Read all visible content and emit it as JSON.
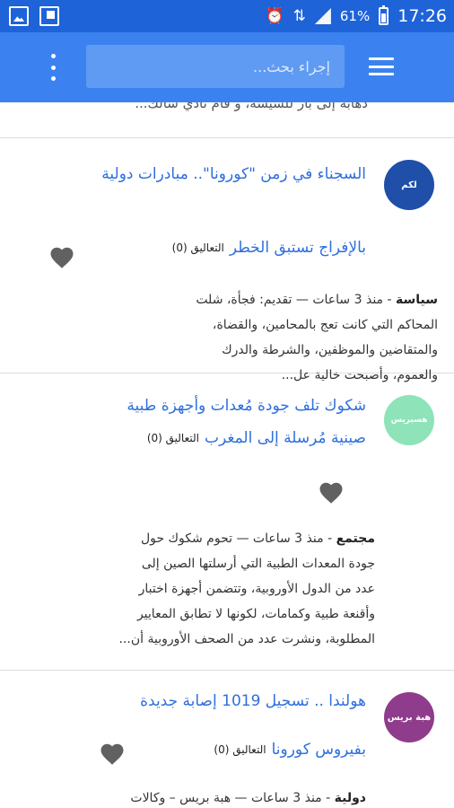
{
  "statusbar": {
    "wifi": "⇅",
    "battery_pct": "61%",
    "time": "17:26"
  },
  "appbar": {
    "search_placeholder": "إجراء بحث..."
  },
  "partial_item": {
    "summary": "دهابه إلى بار للشيشة، و قام نادي سالك..."
  },
  "articles": [
    {
      "avatar_text": "لكم",
      "avatar_color": "#1f4fa8",
      "title_line1": "السجناء في زمن \"كورونا\".. مبادرات دولية",
      "title_line2": "بالإفراج تستبق الخطر",
      "comments": "التعاليق (0)",
      "category": "سياسة",
      "time": " - منذ 3 ساعات — ",
      "summary_lines": [
        "تقديم: فجأة، شلت",
        "المحاكم التي كانت تعج بالمحامين، والقضاة،",
        "والمتقاضين والموظفين، والشرطة والدرك",
        "والعموم، وأصبحت خالية عل..."
      ]
    },
    {
      "avatar_text": "هسبريس",
      "avatar_color": "#8ee3b9",
      "title_line1": "شكوك تلف جودة مُعدات وأجهزة طبية",
      "title_line2": "صينية مُرسلة إلى المغرب",
      "comments": "التعاليق (0)",
      "category": "مجتمع",
      "time": " - منذ 3 ساعات — ",
      "summary_lines": [
        "تحوم شكوك حول",
        "جودة المعدات الطبية التي أرسلتها الصين إلى",
        "عدد من الدول الأوروبية، وتتضمن أجهزة اختبار",
        "وأقنعة طبية وكمامات، لكونها لا تطابق المعايير",
        "المطلوبة، ونشرت عدد من الصحف الأوروبية أن..."
      ]
    },
    {
      "avatar_text": "هبة بريس",
      "avatar_color": "#8e3c8b",
      "title_line1": "هولندا .. تسجيل 1019 إصابة جديدة",
      "title_line2": "بفيروس كورونا",
      "comments": "التعاليق (0)",
      "category": "دولية",
      "time": " - منذ 3 ساعات — ",
      "summary_lines": [
        "هبة بريس – وكالات"
      ]
    }
  ]
}
